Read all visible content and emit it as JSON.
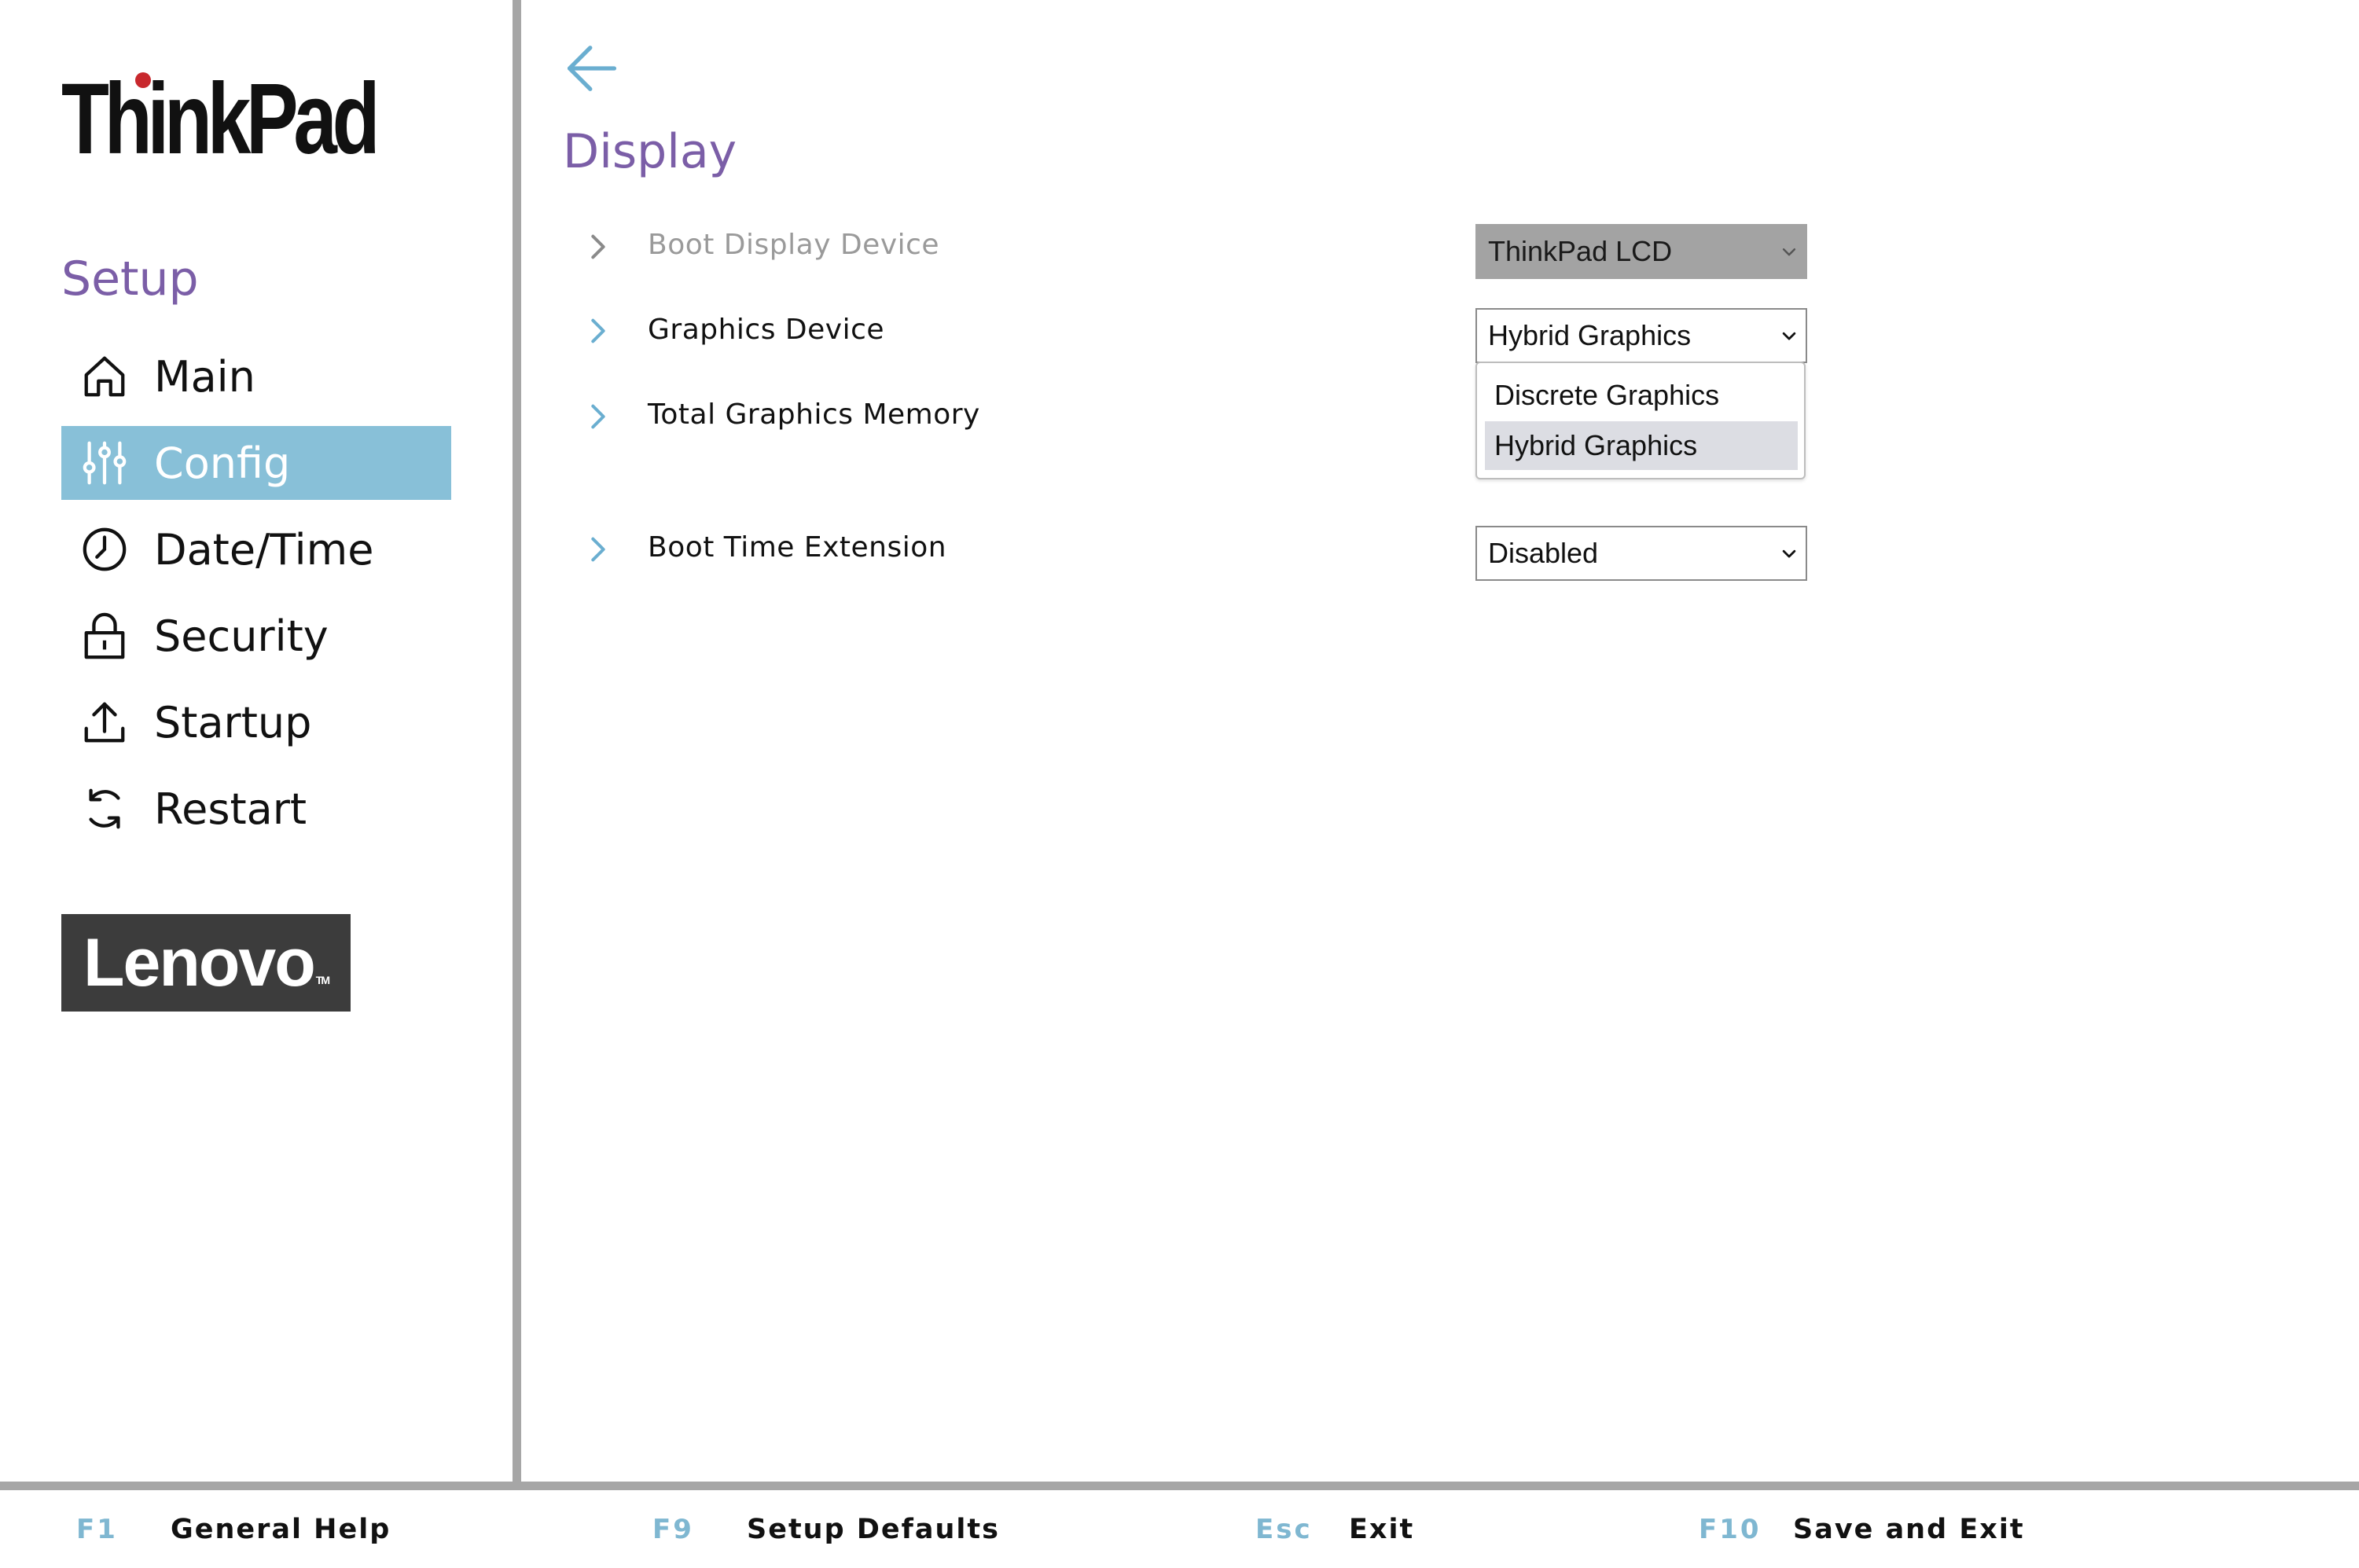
{
  "brand": {
    "logo_text": "ThinkPad",
    "vendor_text": "Lenovo",
    "vendor_tm": "TM"
  },
  "sidebar": {
    "title": "Setup",
    "items": [
      {
        "label": "Main",
        "icon": "home-icon",
        "active": false
      },
      {
        "label": "Config",
        "icon": "sliders-icon",
        "active": true
      },
      {
        "label": "Date/Time",
        "icon": "clock-icon",
        "active": false
      },
      {
        "label": "Security",
        "icon": "lock-icon",
        "active": false
      },
      {
        "label": "Startup",
        "icon": "upload-icon",
        "active": false
      },
      {
        "label": "Restart",
        "icon": "restart-icon",
        "active": false
      }
    ]
  },
  "main": {
    "title": "Display",
    "settings": [
      {
        "label": "Boot Display Device",
        "value": "ThinkPad LCD",
        "disabled": true
      },
      {
        "label": "Graphics Device",
        "value": "Hybrid Graphics",
        "disabled": false
      },
      {
        "label": "Total Graphics Memory",
        "value": "",
        "disabled": false
      },
      {
        "label": "Boot Time Extension",
        "value": "Disabled",
        "disabled": false
      }
    ],
    "dropdown": {
      "options": [
        "Discrete Graphics",
        "Hybrid Graphics"
      ],
      "selected": "Hybrid Graphics"
    }
  },
  "footer": {
    "keys": [
      {
        "key": "F1",
        "label": "General Help"
      },
      {
        "key": "F9",
        "label": "Setup Defaults"
      },
      {
        "key": "Esc",
        "label": "Exit"
      },
      {
        "key": "F10",
        "label": "Save and Exit"
      }
    ]
  },
  "colors": {
    "accent_purple": "#7b5ea7",
    "active_blue": "#88c0d8",
    "fkey_blue": "#7fb7d1",
    "border_gray": "#a6a6a6"
  }
}
